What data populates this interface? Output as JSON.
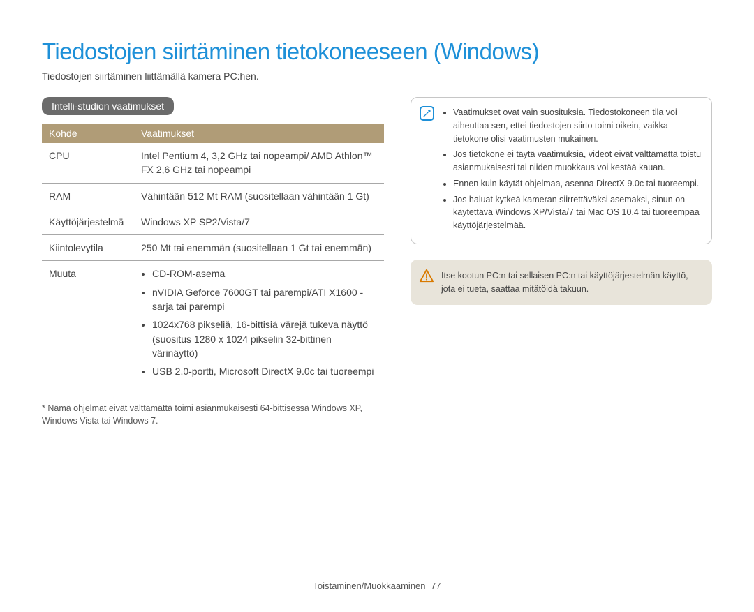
{
  "title": "Tiedostojen siirtäminen tietokoneeseen (Windows)",
  "subtitle": "Tiedostojen siirtäminen liittämällä kamera PC:hen.",
  "section_label": "Intelli-studion vaatimukset",
  "table": {
    "headers": {
      "col1": "Kohde",
      "col2": "Vaatimukset"
    },
    "rows": {
      "cpu": {
        "label": "CPU",
        "value": "Intel Pentium 4, 3,2 GHz tai nopeampi/\nAMD Athlon™ FX 2,6 GHz tai nopeampi"
      },
      "ram": {
        "label": "RAM",
        "value": "Vähintään 512 Mt RAM\n(suositellaan vähintään 1 Gt)"
      },
      "os": {
        "label": "Käyttöjärjestelmä",
        "value": "Windows XP SP2/Vista/7"
      },
      "hdd": {
        "label": "Kiintolevytila",
        "value": "250 Mt tai enemmän\n(suositellaan 1 Gt tai enemmän)"
      },
      "other_label": "Muuta",
      "other_items": [
        "CD-ROM-asema",
        "nVIDIA Geforce 7600GT tai parempi/ATI X1600 -sarja tai parempi",
        "1024x768 pikseliä, 16-bittisiä värejä tukeva näyttö (suositus 1280 x 1024 pikselin 32-bittinen värinäyttö)",
        "USB 2.0-portti, Microsoft DirectX 9.0c tai tuoreempi"
      ]
    }
  },
  "footnote": "* Nämä ohjelmat eivät välttämättä toimi asianmukaisesti 64-bittisessä Windows XP, Windows Vista tai Windows 7.",
  "note_items": [
    "Vaatimukset ovat vain suosituksia. Tiedostokoneen tila voi aiheuttaa sen, ettei tiedostojen siirto toimi oikein, vaikka tietokone olisi vaatimusten mukainen.",
    "Jos tietokone ei täytä vaatimuksia, videot eivät välttämättä toistu asianmukaisesti tai niiden muokkaus voi kestää kauan.",
    "Ennen kuin käytät ohjelmaa, asenna DirectX 9.0c tai tuoreempi.",
    "Jos haluat kytkeä kameran siirrettäväksi asemaksi, sinun on käytettävä Windows XP/Vista/7 tai Mac OS 10.4 tai tuoreempaa käyttöjärjestelmää."
  ],
  "warn_text": "Itse kootun PC:n tai sellaisen PC:n tai käyttöjärjestelmän käyttö, jota ei tueta, saattaa mitätöidä takuun.",
  "footer": {
    "section": "Toistaminen/Muokkaaminen",
    "page": "77"
  },
  "colors": {
    "accent": "#1e90d8",
    "table_header": "#b09c77",
    "warn_bg": "#e8e4da"
  }
}
